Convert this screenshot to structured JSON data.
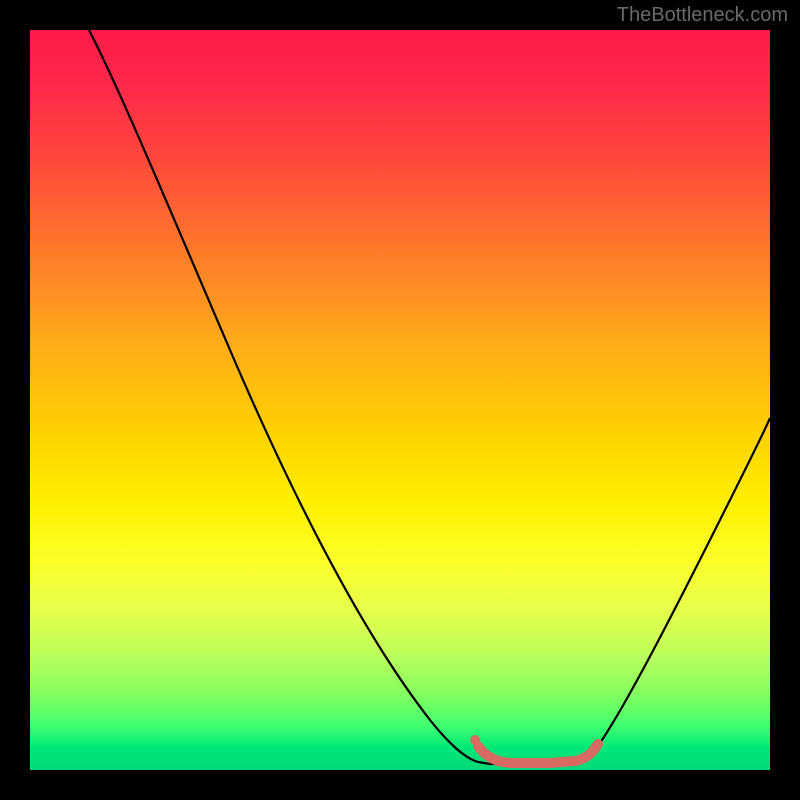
{
  "watermark": "TheBottleneck.com",
  "chart_data": {
    "type": "line",
    "title": "",
    "xlabel": "",
    "ylabel": "",
    "xlim": [
      0,
      100
    ],
    "ylim": [
      0,
      100
    ],
    "series": [
      {
        "name": "black-curve",
        "x": [
          8,
          15,
          22,
          30,
          38,
          46,
          54,
          58,
          60,
          63,
          68,
          73,
          76,
          78,
          82,
          88,
          94,
          100
        ],
        "y": [
          100,
          88,
          76,
          62,
          48,
          34,
          18,
          8,
          3,
          1,
          1,
          1,
          3,
          6,
          14,
          28,
          42,
          56
        ]
      },
      {
        "name": "pink-highlight",
        "x": [
          60,
          62,
          65,
          68,
          71,
          73,
          75,
          76
        ],
        "y": [
          3,
          1.5,
          1,
          1,
          1,
          1.5,
          2.5,
          4
        ]
      }
    ],
    "highlight_color": "#d86a62",
    "background_gradient": {
      "top": "#ff1a4a",
      "mid": "#fff000",
      "bottom": "#00d878"
    }
  }
}
